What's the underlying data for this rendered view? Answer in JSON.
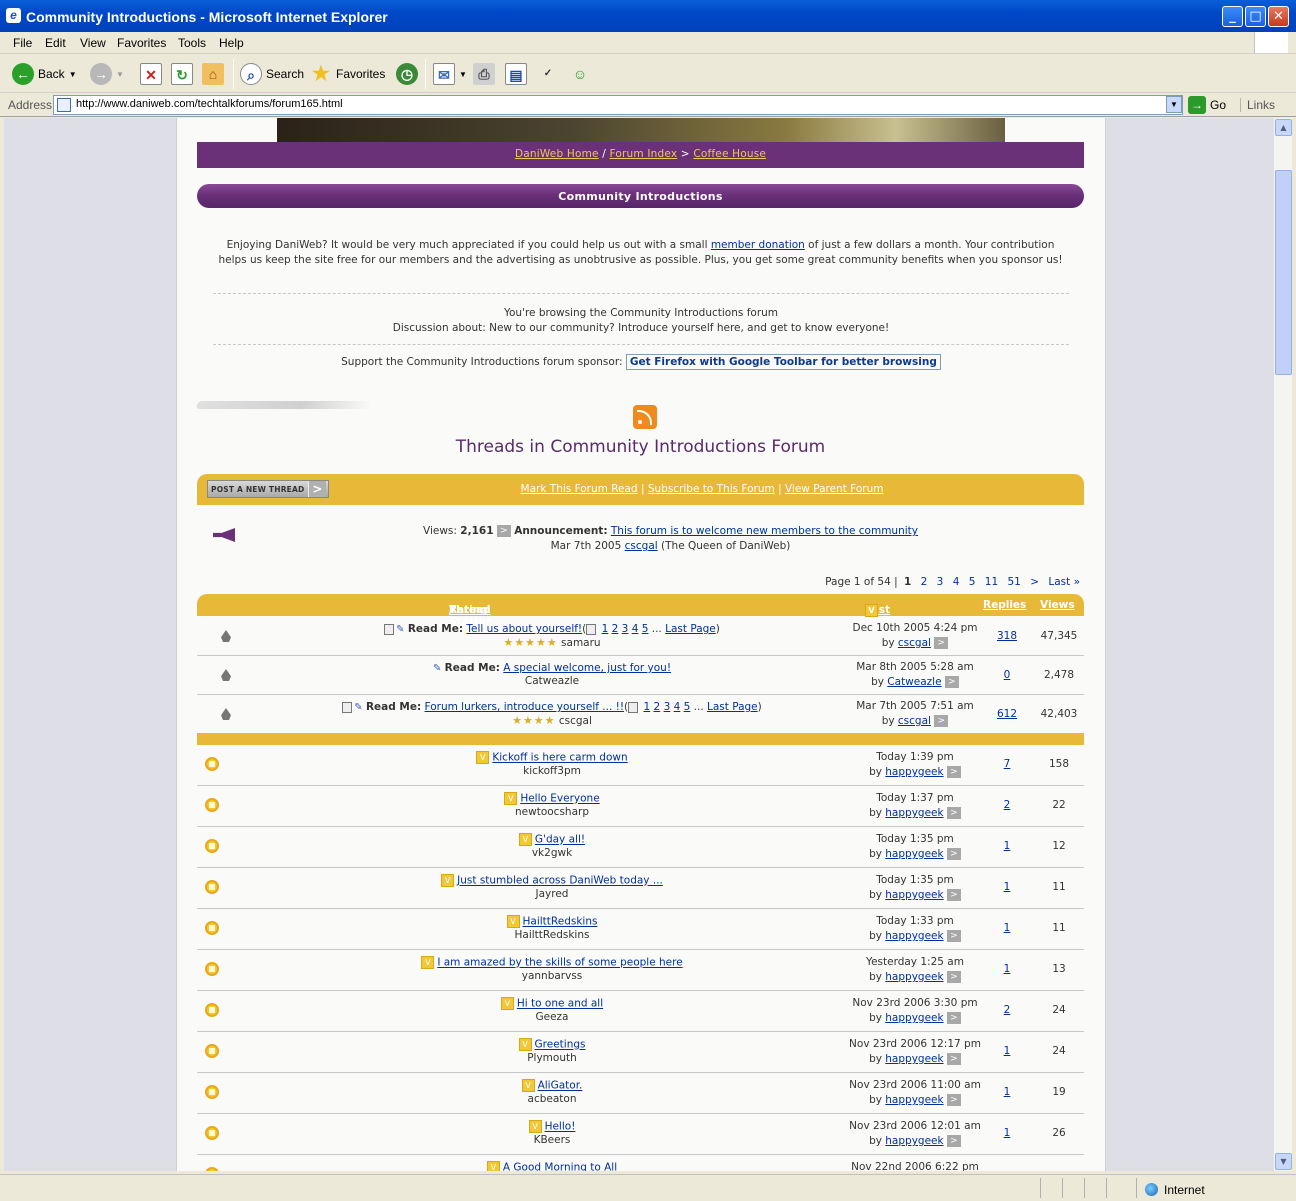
{
  "window": {
    "title": "Community Introductions - Microsoft Internet Explorer",
    "buttons": [
      "_",
      "□",
      "✕"
    ]
  },
  "menu": [
    "File",
    "Edit",
    "View",
    "Favorites",
    "Tools",
    "Help"
  ],
  "toolbar": {
    "back": "Back",
    "search": "Search",
    "favorites": "Favorites"
  },
  "address": {
    "label": "Address",
    "url": "http://www.daniweb.com/techtalkforums/forum165.html",
    "go": "Go",
    "links": "Links"
  },
  "status": {
    "zone": "Internet"
  },
  "breadcrumb": {
    "home": "DaniWeb Home",
    "sep1": "/",
    "index": "Forum Index",
    "sep2": ">",
    "current": "Coffee House"
  },
  "forum_header": "Community Introductions",
  "donation": {
    "pre": "Enjoying DaniWeb? It would be very much appreciated if you could help us out with a small ",
    "link": "member donation",
    "post": " of just a few dollars a month. Your contribution helps us keep the site free for our members and the advertising as unobtrusive as possible. Plus, you get some great community benefits when you sponsor us!"
  },
  "browsing": {
    "line1": "You're browsing the Community Introductions forum",
    "line2": "Discussion about: New to our community? Introduce yourself here, and get to know everyone!"
  },
  "sponsor": {
    "label": "Support the Community Introductions forum sponsor:",
    "link": "Get Firefox with Google Toolbar for better browsing"
  },
  "threads_title": "Threads in Community Introductions Forum",
  "actions": {
    "post_new": "POST A NEW THREAD",
    "mark_read": "Mark This Forum Read",
    "subscribe": "Subscribe to This Forum",
    "view_parent": "View Parent Forum",
    "sep": "|"
  },
  "announcement": {
    "views_label": "Views:",
    "views": "2,161",
    "label": "Announcement:",
    "title": "This forum is to welcome new members to the community",
    "date": "Mar 7th 2005",
    "author": "cscgal",
    "author_title": "(The Queen of DaniWeb)"
  },
  "pager": {
    "text": "Page 1 of 54",
    "current": "1",
    "pages": [
      "2",
      "3",
      "4",
      "5",
      "11",
      "51",
      ">"
    ],
    "last": "Last »"
  },
  "columns": {
    "rating": "Rating",
    "thread": "Thread",
    "slash": "/",
    "starter": "Thread Starter",
    "last_post": "Last Post",
    "replies": "Replies",
    "views": "Views"
  },
  "sticky": [
    {
      "prefix": "Read Me:",
      "title": "Tell us about yourself!",
      "pages": [
        "1",
        "2",
        "3",
        "4",
        "5"
      ],
      "last_page": "Last Page",
      "stars": "★★★★★",
      "starter": "samaru",
      "date": "Dec 10th 2005 4:24 pm",
      "by": "cscgal",
      "replies": "318",
      "views": "47,345"
    },
    {
      "prefix": "Read Me:",
      "title": "A special welcome, just for you!",
      "pages": [],
      "last_page": "",
      "stars": "",
      "starter": "Catweazle",
      "date": "Mar 8th 2005 5:28 am",
      "by": "Catweazle",
      "replies": "0",
      "views": "2,478"
    },
    {
      "prefix": "Read Me:",
      "title": "Forum lurkers, introduce yourself ... !!",
      "pages": [
        "1",
        "2",
        "3",
        "4",
        "5"
      ],
      "last_page": "Last Page",
      "stars": "★★★★",
      "starter": "cscgal",
      "date": "Mar 7th 2005 7:51 am",
      "by": "cscgal",
      "replies": "612",
      "views": "42,403"
    }
  ],
  "threads": [
    {
      "title": "Kickoff is here carm down",
      "starter": "kickoff3pm",
      "date": "Today 1:39 pm",
      "by": "happygeek",
      "replies": "7",
      "views": "158"
    },
    {
      "title": "Hello Everyone",
      "starter": "newtoocsharp",
      "date": "Today 1:37 pm",
      "by": "happygeek",
      "replies": "2",
      "views": "22"
    },
    {
      "title": "G'day all!",
      "starter": "vk2gwk",
      "date": "Today 1:35 pm",
      "by": "happygeek",
      "replies": "1",
      "views": "12"
    },
    {
      "title": "Just stumbled across DaniWeb today ...",
      "starter": "Jayred",
      "date": "Today 1:35 pm",
      "by": "happygeek",
      "replies": "1",
      "views": "11"
    },
    {
      "title": "HailttRedskins",
      "starter": "HailttRedskins",
      "date": "Today 1:33 pm",
      "by": "happygeek",
      "replies": "1",
      "views": "11"
    },
    {
      "title": "I am amazed by the skills of some people here",
      "starter": "yannbarvss",
      "date": "Yesterday 1:25 am",
      "by": "happygeek",
      "replies": "1",
      "views": "13"
    },
    {
      "title": "Hi to one and all",
      "starter": "Geeza",
      "date": "Nov 23rd 2006 3:30 pm",
      "by": "happygeek",
      "replies": "2",
      "views": "24"
    },
    {
      "title": "Greetings",
      "starter": "Plymouth",
      "date": "Nov 23rd 2006 12:17 pm",
      "by": "happygeek",
      "replies": "1",
      "views": "24"
    },
    {
      "title": "AliGator.",
      "starter": "acbeaton",
      "date": "Nov 23rd 2006 11:00 am",
      "by": "happygeek",
      "replies": "1",
      "views": "19"
    },
    {
      "title": "Hello!",
      "starter": "KBeers",
      "date": "Nov 23rd 2006 12:01 am",
      "by": "happygeek",
      "replies": "1",
      "views": "26"
    },
    {
      "title": "A Good Morning to All",
      "starter": "",
      "date": "Nov 22nd 2006 6:22 pm",
      "by": "",
      "replies": "",
      "views": ""
    }
  ]
}
